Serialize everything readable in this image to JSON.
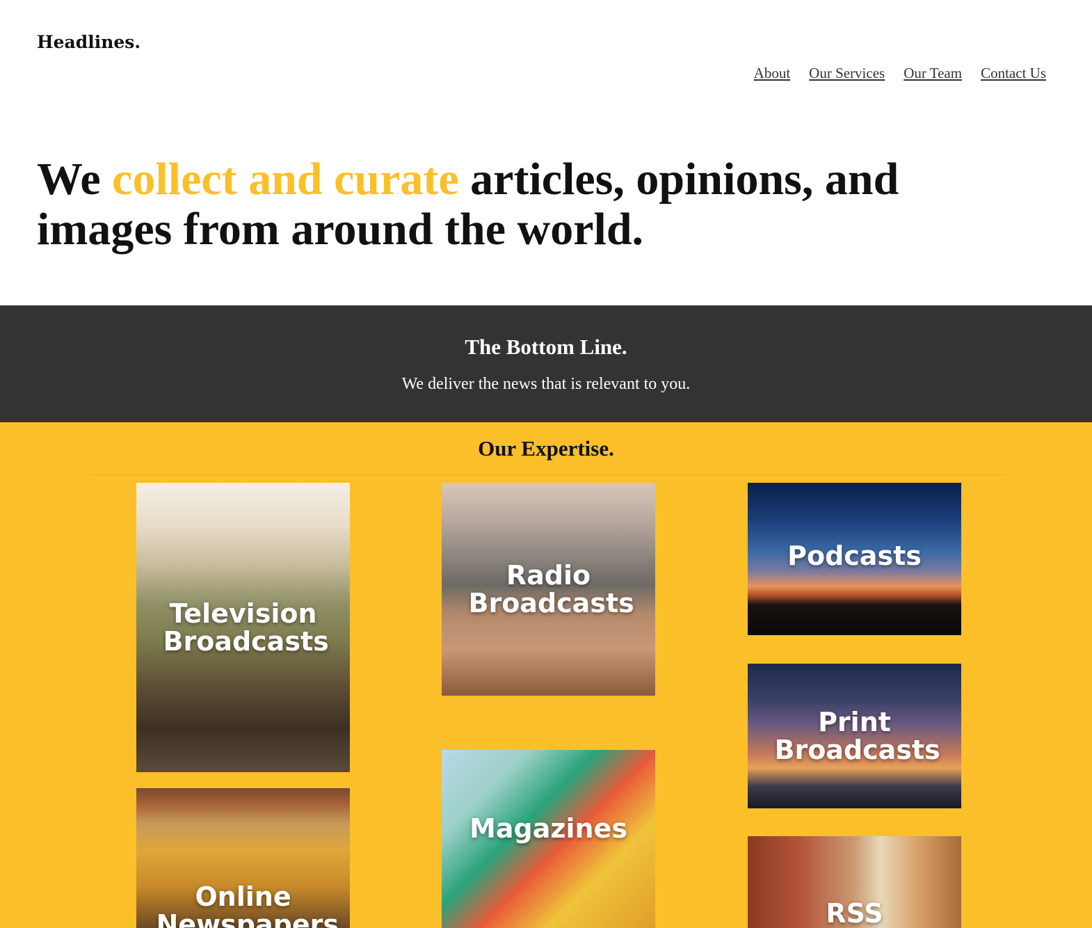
{
  "header": {
    "logo": "Headlines.",
    "nav": [
      {
        "label": "About"
      },
      {
        "label": "Our Services"
      },
      {
        "label": "Our Team"
      },
      {
        "label": "Contact Us"
      }
    ]
  },
  "hero": {
    "lead": "We ",
    "accent": "collect and curate",
    "rest": " articles, opinions, and images from around the world."
  },
  "bottom_line": {
    "title": "The Bottom Line.",
    "subtitle": "We deliver the news that is relevant to you."
  },
  "expertise": {
    "title": "Our Expertise.",
    "tiles": [
      {
        "label": "Television Broadcasts"
      },
      {
        "label": "Online Newspapers"
      },
      {
        "label": "Radio Broadcasts"
      },
      {
        "label": "Magazines"
      },
      {
        "label": "Podcasts"
      },
      {
        "label": "Print Broadcasts"
      },
      {
        "label": "RSS Readers"
      }
    ]
  },
  "colors": {
    "accent": "#fbbf2a",
    "dark_band": "#333333"
  }
}
